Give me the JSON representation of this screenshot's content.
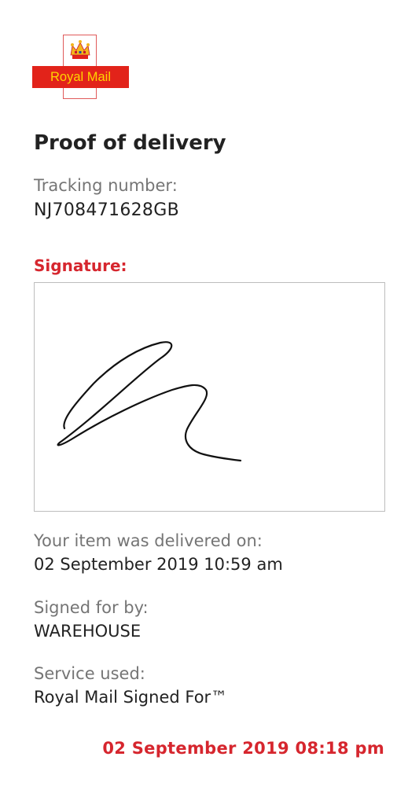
{
  "brand": {
    "logo_text": "Royal Mail",
    "primary_color": "#e2231a",
    "logo_text_color": "#ffd400",
    "crown_icon": "crown-icon"
  },
  "page": {
    "title": "Proof of delivery"
  },
  "tracking": {
    "label": "Tracking number:",
    "value": "NJ708471628GB"
  },
  "signature": {
    "label": "Signature:",
    "accent_color": "#d6262e"
  },
  "delivery": {
    "label": "Your item was delivered on:",
    "value": "02 September 2019 10:59 am"
  },
  "signed_for": {
    "label": "Signed for by:",
    "value": "WAREHOUSE"
  },
  "service": {
    "label": "Service used:",
    "value": "Royal Mail Signed For™"
  },
  "screenshot_timestamp": "02 September 2019 08:18 pm"
}
